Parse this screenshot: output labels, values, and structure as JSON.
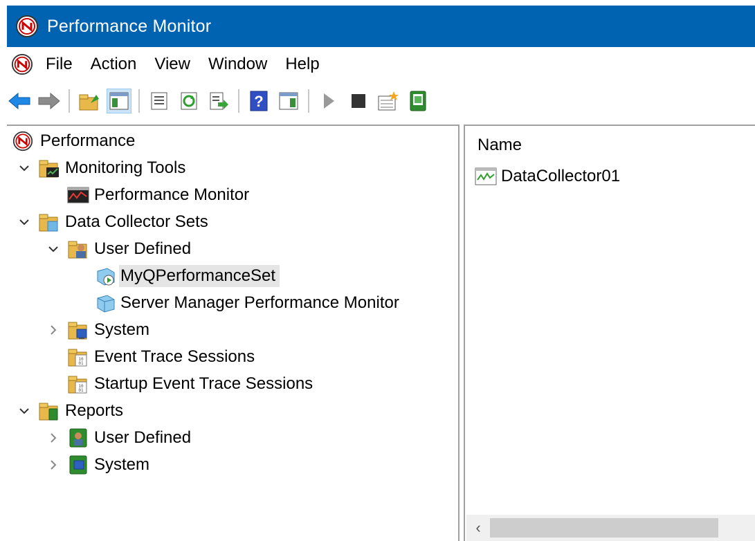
{
  "window": {
    "title": "Performance Monitor"
  },
  "menu": {
    "items": [
      "File",
      "Action",
      "View",
      "Window",
      "Help"
    ]
  },
  "toolbar": {
    "buttons": [
      "back-arrow-icon",
      "forward-arrow-icon",
      "up-folder-icon",
      "show-hide-tree-icon",
      "properties-icon",
      "refresh-icon",
      "export-list-icon",
      "help-icon",
      "show-hide-action-pane-icon",
      "start-icon",
      "stop-icon",
      "new-icon",
      "data-collector-set-icon"
    ]
  },
  "tree": {
    "root": "Performance",
    "monitoring_tools": "Monitoring Tools",
    "performance_monitor": "Performance Monitor",
    "data_collector_sets": "Data Collector Sets",
    "user_defined": "User Defined",
    "my_set": "MyQPerformanceSet",
    "server_manager": "Server Manager Performance Monitor",
    "system": "System",
    "event_trace": "Event Trace Sessions",
    "startup_event_trace": "Startup Event Trace Sessions",
    "reports": "Reports",
    "reports_user_defined": "User Defined",
    "reports_system": "System"
  },
  "list": {
    "column_name": "Name",
    "items": [
      "DataCollector01"
    ]
  },
  "colors": {
    "titlebar": "#0063b1",
    "selection": "#e5e5e5"
  }
}
